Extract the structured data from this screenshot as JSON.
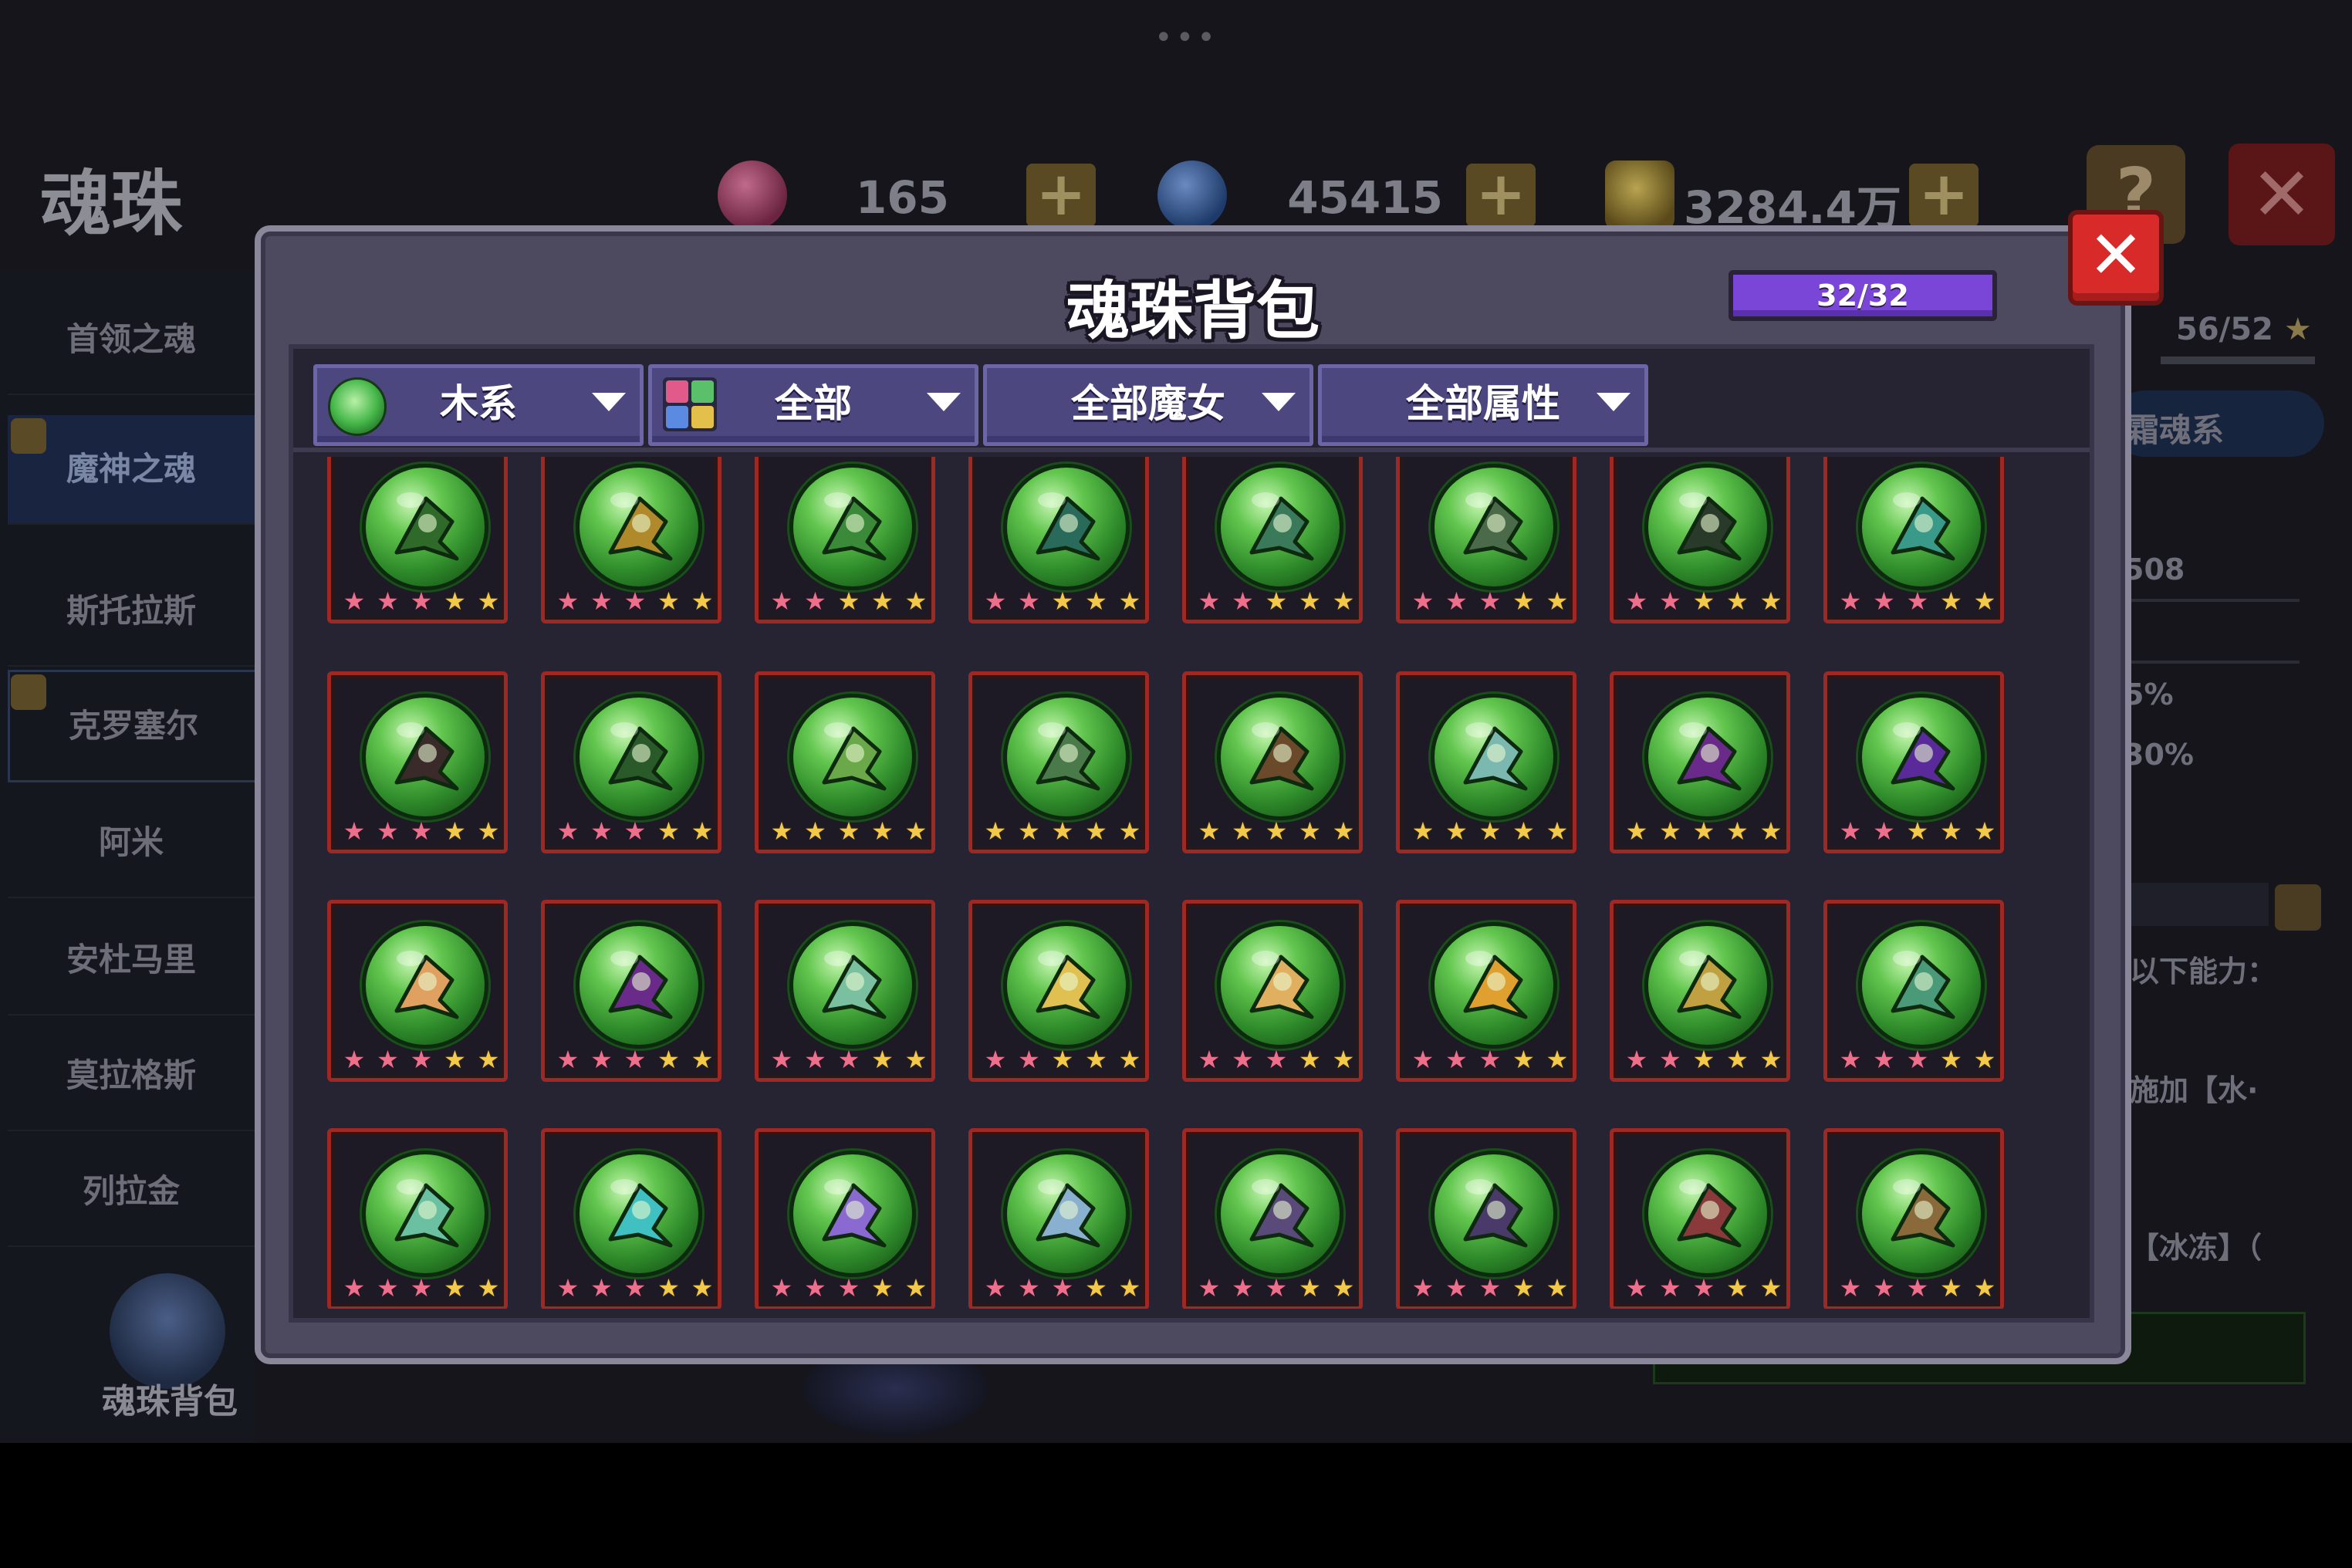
{
  "background": {
    "page_title": "魂珠",
    "resources": [
      {
        "icon": "red-gem-icon",
        "value": "165"
      },
      {
        "icon": "blue-gem-icon",
        "value": "45415"
      },
      {
        "icon": "gold-coin-icon",
        "value": "3284.4万"
      }
    ],
    "help_label": "?",
    "close_label": "✕",
    "sidebar": [
      {
        "label": "首领之魂"
      },
      {
        "label": "魔神之魂"
      },
      {
        "label": "斯托拉斯"
      },
      {
        "label": "克罗塞尔"
      },
      {
        "label": "阿米"
      },
      {
        "label": "安杜马里"
      },
      {
        "label": "莫拉格斯"
      },
      {
        "label": "列拉金"
      }
    ],
    "bag_label": "魂珠背包",
    "right_panel": {
      "counter": "56/52",
      "tab": "霜魂系",
      "value1": "508",
      "value2": "5%",
      "value3": "30%",
      "line1": "以下能力：",
      "line2": "施加【水·",
      "line3": "【冰冻】（"
    }
  },
  "modal": {
    "title": "魂珠背包",
    "capacity": "32/32",
    "close_label": "✕",
    "filters": [
      {
        "label": "木系",
        "icon": "wood-element-icon"
      },
      {
        "label": "全部",
        "icon": "all-types-icon"
      },
      {
        "label": "全部魔女",
        "icon": ""
      },
      {
        "label": "全部属性",
        "icon": ""
      }
    ],
    "colors": {
      "star_gold": "#f2c94a",
      "star_pink": "#ec6f8c",
      "frame_red": "#9e2824",
      "orb_green": "#62c64e"
    },
    "orbs": [
      {
        "name": "green-spirit-orb",
        "stars": [
          1,
          1,
          1,
          0,
          0
        ]
      },
      {
        "name": "gold-rune-orb",
        "stars": [
          1,
          1,
          1,
          0,
          0
        ]
      },
      {
        "name": "leaf-key-orb",
        "stars": [
          1,
          1,
          0,
          0,
          0
        ]
      },
      {
        "name": "serpent-orb",
        "stars": [
          1,
          1,
          0,
          0,
          0
        ]
      },
      {
        "name": "blade-serpent-orb",
        "stars": [
          1,
          1,
          0,
          0,
          0
        ]
      },
      {
        "name": "skull-staff-orb",
        "stars": [
          1,
          1,
          1,
          0,
          0
        ]
      },
      {
        "name": "cannon-orb",
        "stars": [
          1,
          1,
          0,
          0,
          0
        ]
      },
      {
        "name": "teal-dragon-orb",
        "stars": [
          1,
          1,
          1,
          0,
          0
        ]
      },
      {
        "name": "dark-sword-orb",
        "stars": [
          1,
          1,
          1,
          0,
          0
        ]
      },
      {
        "name": "crescent-orb",
        "stars": [
          1,
          1,
          1,
          0,
          0
        ]
      },
      {
        "name": "green-scythe-orb",
        "stars": [
          0,
          0,
          0,
          0,
          0
        ]
      },
      {
        "name": "tree-spear-orb",
        "stars": [
          0,
          0,
          0,
          0,
          0
        ]
      },
      {
        "name": "torch-staff-orb",
        "stars": [
          0,
          0,
          0,
          0,
          0
        ]
      },
      {
        "name": "crystal-fan-orb",
        "stars": [
          0,
          0,
          0,
          0,
          0
        ]
      },
      {
        "name": "violet-wing-orb",
        "stars": [
          0,
          0,
          0,
          0,
          0
        ]
      },
      {
        "name": "amethyst-blade-orb",
        "stars": [
          1,
          1,
          0,
          0,
          0
        ]
      },
      {
        "name": "flame-bird-orb",
        "stars": [
          1,
          1,
          1,
          0,
          0
        ]
      },
      {
        "name": "purple-beast-orb",
        "stars": [
          1,
          1,
          1,
          0,
          0
        ]
      },
      {
        "name": "jade-leaf-orb",
        "stars": [
          1,
          1,
          1,
          0,
          0
        ]
      },
      {
        "name": "golden-ring-orb",
        "stars": [
          1,
          1,
          0,
          0,
          0
        ]
      },
      {
        "name": "golden-fish-orb",
        "stars": [
          1,
          1,
          1,
          0,
          0
        ]
      },
      {
        "name": "golden-flower-orb",
        "stars": [
          1,
          1,
          1,
          0,
          0
        ]
      },
      {
        "name": "golden-sword-orb",
        "stars": [
          1,
          1,
          0,
          0,
          0
        ]
      },
      {
        "name": "vine-orb",
        "stars": [
          1,
          1,
          1,
          0,
          0
        ]
      },
      {
        "name": "swirl-orb",
        "stars": [
          1,
          1,
          1,
          0,
          0
        ]
      },
      {
        "name": "cyan-glow-orb",
        "stars": [
          1,
          1,
          1,
          0,
          0
        ]
      },
      {
        "name": "violet-shell-orb",
        "stars": [
          1,
          1,
          1,
          0,
          0
        ]
      },
      {
        "name": "storm-cloud-orb",
        "stars": [
          1,
          1,
          1,
          0,
          0
        ]
      },
      {
        "name": "mandala-orb",
        "stars": [
          1,
          1,
          1,
          0,
          0
        ]
      },
      {
        "name": "dark-mandala-orb",
        "stars": [
          1,
          1,
          1,
          0,
          0
        ]
      },
      {
        "name": "rose-beast-orb",
        "stars": [
          1,
          1,
          1,
          0,
          0
        ]
      },
      {
        "name": "gold-beast-orb",
        "stars": [
          1,
          1,
          1,
          0,
          0
        ]
      }
    ]
  }
}
